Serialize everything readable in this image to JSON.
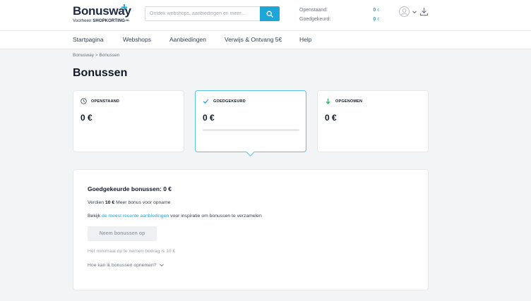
{
  "brand": {
    "name": "Bonusway",
    "plus": "+",
    "sub_prefix": "Voorheen",
    "sub_brand": "SHOPKORTING",
    "sub_suffix": ".NL"
  },
  "search": {
    "placeholder": "Ontdek webshops, aanbiedingen en meer...",
    "icon": "search-icon"
  },
  "header_stats": {
    "pending_label": "Openstaand:",
    "pending_value": "0",
    "approved_label": "Goedgekeurd:",
    "approved_value": "0",
    "currency": "€"
  },
  "nav": {
    "items": [
      {
        "label": "Startpagina"
      },
      {
        "label": "Webshops"
      },
      {
        "label": "Aanbiedingen"
      },
      {
        "label": "Verwijs & Ontvang 5€"
      },
      {
        "label": "Help"
      }
    ]
  },
  "breadcrumb": "Bonusway > Bonussen",
  "page": {
    "title": "Bonussen"
  },
  "cards": [
    {
      "label": "OPENSTAAND",
      "amount": "0 €",
      "icon": "clock-icon"
    },
    {
      "label": "GOEDGEKEURD",
      "amount": "0 €",
      "icon": "check-icon",
      "progress": 0
    },
    {
      "label": "OPGENOMEN",
      "amount": "0 €",
      "icon": "arrow-down-icon"
    }
  ],
  "panel": {
    "title": "Goedgekeurde bonussen: 0 €",
    "earn_prefix": "Verdien",
    "earn_amount": "10 €",
    "earn_suffix": "Meer bonus voor opname",
    "look_prefix": "Bekijk",
    "look_link": "de meest recente aanbiedingen",
    "look_suffix": "voor inspiratie om bonussen te verzamelen",
    "button_label": "Neem bonussen op",
    "minimum_text": "Het minimaal op te nemen bedrag is 10 €",
    "howto_text": "Hoe kan ik bonussen opnemen?"
  },
  "colors": {
    "accent": "#1ea7d6",
    "brand_dark": "#1e2a44",
    "background": "#f3f4f6"
  }
}
